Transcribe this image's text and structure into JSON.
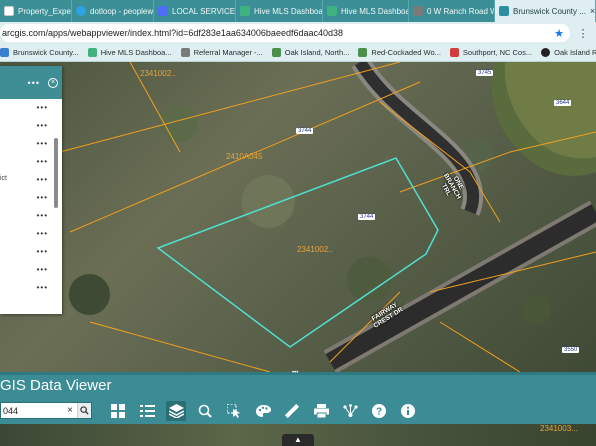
{
  "browser": {
    "tabs": [
      {
        "title": "Property_Expense...",
        "color": "#ffffff",
        "active": false
      },
      {
        "title": "dotloop - peoplew",
        "color": "#2ea3e3",
        "active": false
      },
      {
        "title": "LOCAL SERVICE PR",
        "color": "#4c6ef5",
        "active": false
      },
      {
        "title": "Hive MLS Dashboar",
        "color": "#3fb27f",
        "active": false
      },
      {
        "title": "Hive MLS Dashboa",
        "color": "#3fb27f",
        "active": false
      },
      {
        "title": "0 W Ranch Road W",
        "color": "#7a7a7a",
        "active": false
      },
      {
        "title": "Brunswick County ...",
        "color": "#2a8fa0",
        "active": true
      }
    ],
    "url": "arcgis.com/apps/webappviewer/index.html?id=6df283e1aa634006baeedf6daac40d38",
    "bookmarks": [
      {
        "label": "Brunswick County...",
        "color": "#3a7fd1"
      },
      {
        "label": "Hive MLS Dashboa...",
        "color": "#3fb27f"
      },
      {
        "label": "Referral Manager -...",
        "color": "#7a7a7a"
      },
      {
        "label": "Oak Island, North...",
        "color": "#4a8f4a"
      },
      {
        "label": "Red-Cockaded Wo...",
        "color": "#4a8f4a"
      },
      {
        "label": "Southport, NC Cos...",
        "color": "#d33c3c"
      },
      {
        "label": "Oak Island Restaur...",
        "color": "#222222"
      }
    ]
  },
  "panel": {
    "header_dots": "•••",
    "close_symbol": "×",
    "row_dots": "•••",
    "row_text_ict": "ict"
  },
  "map": {
    "parcel_numbers": [
      "2341002..",
      "2410A045",
      "2341002.."
    ],
    "address_labels": [
      "3745",
      "3744",
      "3744",
      "3644",
      "3550"
    ],
    "roads": [
      "ONE\nBRANCH\nTRL",
      "FAIRWAY\nCREST DR"
    ],
    "highlight_color": "#4fe0cf",
    "parcel_line_color": "#f0a020"
  },
  "app": {
    "title": "GIS Data Viewer",
    "search_value": "044",
    "search_clear": "×",
    "search_icon": "search-icon",
    "tools": [
      "basemap-gallery-icon",
      "legend-icon",
      "layer-list-icon",
      "query-icon",
      "select-icon",
      "symbology-icon",
      "measure-icon",
      "print-icon",
      "share-icon",
      "help-icon",
      "about-icon"
    ],
    "bottom_parcel": "2341003..."
  }
}
